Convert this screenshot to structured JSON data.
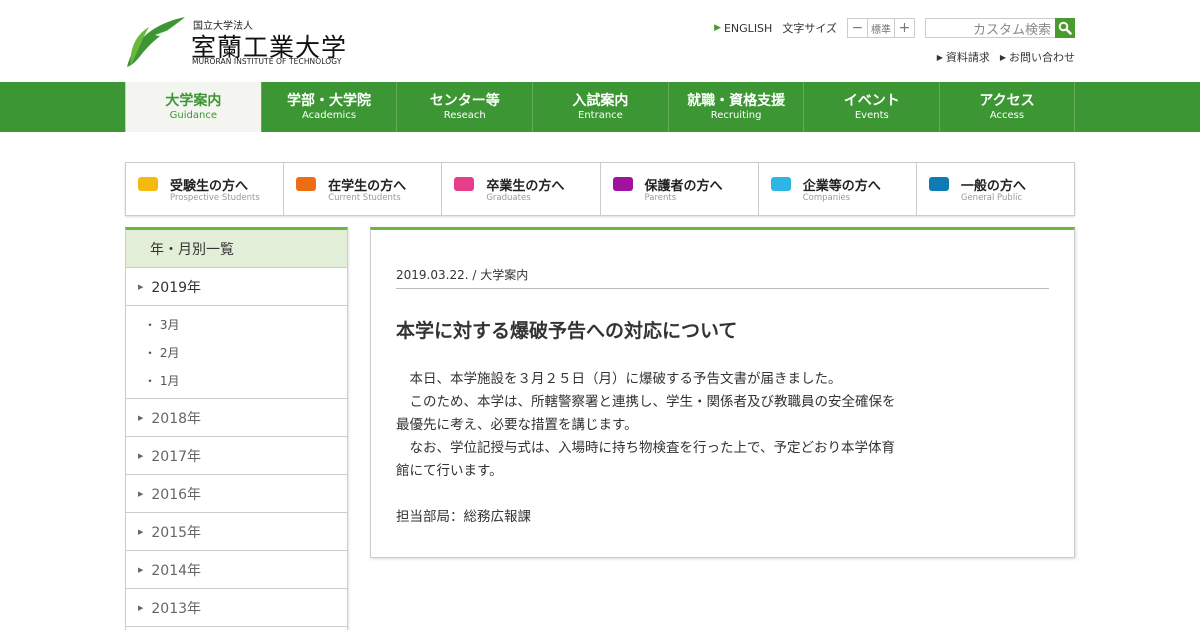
{
  "header": {
    "logo_small": "国立大学法人",
    "logo_main": "室蘭工業大学",
    "logo_en": "MURORAN INSTITUTE OF TECHNOLOGY",
    "english_link": "ENGLISH",
    "font_size_label": "文字サイズ",
    "font_minus": "−",
    "font_standard": "標準",
    "font_plus": "+",
    "search_value": "カスタム検索",
    "links": [
      "資料請求",
      "お問い合わせ"
    ]
  },
  "gnav": [
    {
      "jp": "大学案内",
      "en": "Guidance",
      "active": true
    },
    {
      "jp": "学部・大学院",
      "en": "Academics"
    },
    {
      "jp": "センター等",
      "en": "Reseach"
    },
    {
      "jp": "入試案内",
      "en": "Entrance"
    },
    {
      "jp": "就職・資格支援",
      "en": "Recruiting"
    },
    {
      "jp": "イベント",
      "en": "Events"
    },
    {
      "jp": "アクセス",
      "en": "Access"
    }
  ],
  "audience": [
    {
      "jp": "受験生の方へ",
      "en": "Prospective Students",
      "color": "#f5b90f"
    },
    {
      "jp": "在学生の方へ",
      "en": "Current Students",
      "color": "#ec6d12"
    },
    {
      "jp": "卒業生の方へ",
      "en": "Graduates",
      "color": "#e73d8a"
    },
    {
      "jp": "保護者の方へ",
      "en": "Parents",
      "color": "#a0139e"
    },
    {
      "jp": "企業等の方へ",
      "en": "Companies",
      "color": "#2db6e5"
    },
    {
      "jp": "一般の方へ",
      "en": "General Public",
      "color": "#0d7cb5"
    }
  ],
  "sidebar": {
    "heading": "年・月別一覧",
    "open_year": "2019年",
    "months": [
      "・ 3月",
      "・ 2月",
      "・ 1月"
    ],
    "years": [
      "2018年",
      "2017年",
      "2016年",
      "2015年",
      "2014年",
      "2013年"
    ]
  },
  "article": {
    "meta": "2019.03.22. / 大学案内",
    "title": "本学に対する爆破予告への対応について",
    "p1": "　本日、本学施設を３月２５日（月）に爆破する予告文書が届きました。",
    "p2": "　このため、本学は、所轄警察署と連携し、学生・関係者及び教職員の安全確保を最優先に考え、必要な措置を講じます。",
    "p3": "　なお、学位記授与式は、入場時に持ち物検査を行った上で、予定どおり本学体育館にて行います。",
    "footer": "担当部局：総務広報課"
  },
  "colors": {
    "brand_green": "#3c9633",
    "accent_green": "#6ab83c"
  }
}
